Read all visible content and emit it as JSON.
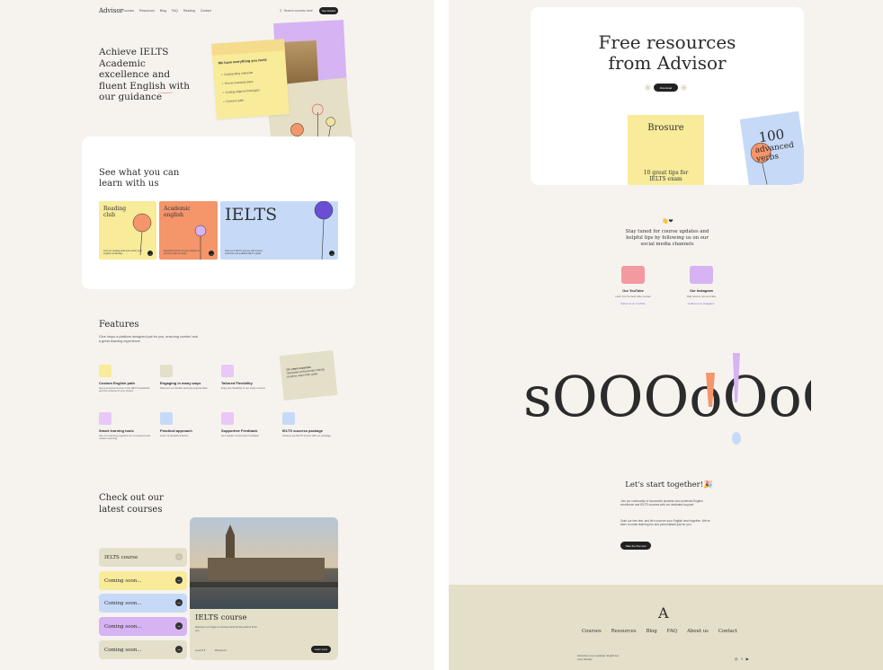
{
  "nav": {
    "logo": "Advisor",
    "links": [
      "Courses",
      "Resources",
      "Blog",
      "FAQ",
      "Reading",
      "Contact"
    ],
    "search_placeholder": "Search courses here",
    "cta": "Get started"
  },
  "hero": {
    "title": "Achieve IELTS Academic excellence and fluent English with our guidance",
    "note_heading": "We have everything you need:",
    "note_items": [
      "Outstanding materials",
      "Proven learning ways",
      "Cutting-edge technologies",
      "Genuine path"
    ]
  },
  "learn": {
    "title": "See what you can learn with us",
    "tiles": [
      {
        "title": "Reading club",
        "desc": "Join our reading club and enrich your english vocabulary",
        "color": "#f8eb9a"
      },
      {
        "title": "Academic english",
        "desc": "Expand horizons of your academic success with our team",
        "color": "#f4956a"
      },
      {
        "title": "IELTS",
        "desc": "Start your IELTS journey with proven methods and qualified IELTS guide",
        "color": "#c6daf8"
      }
    ]
  },
  "features": {
    "title": "Features",
    "subtitle": "Give Inspo a platform designed just for you, ensuring comfort and a great learning experience",
    "items": [
      {
        "name": "Custom English path",
        "desc": "Get a personal course in the IELTS standards and the scheme of your choice",
        "color": "#f8eb9a"
      },
      {
        "name": "Engaging in many ways",
        "desc": "Discover our flexible learning opportunities",
        "color": "#e4dfc8"
      },
      {
        "name": "Tailored Flexibility",
        "desc": "Enjoy the flexibility of our study courses",
        "color": "#e9c8f8"
      },
      {
        "name": "Smart learning tools",
        "desc": "Use our learning programs for convenient and modern learning",
        "color": "#e9c8f8"
      },
      {
        "name": "Practical approach",
        "desc": "Learn by English practice",
        "color": "#c6daf8"
      },
      {
        "name": "Supportive Feedback",
        "desc": "Get regular constructive feedback",
        "color": "#e9c8f8"
      },
      {
        "name": "IELTS success package",
        "desc": "Achieve top IELTS scores with our package",
        "color": "#c6daf8"
      }
    ],
    "quote_title": "10+ years expertise",
    "quote_text": "Dedicated professionals helping students reach their goals"
  },
  "courses": {
    "title": "Check out our latest courses",
    "pills": [
      {
        "label": "IELTS course",
        "color": "#e4dfc8"
      },
      {
        "label": "Coming soon...",
        "color": "#f8eb9a"
      },
      {
        "label": "Coming soon...",
        "color": "#c6daf8"
      },
      {
        "label": "Coming soon...",
        "color": "#d6b3f2"
      },
      {
        "label": "Coming soon...",
        "color": "#e4dfc8"
      }
    ],
    "card": {
      "title": "IELTS course",
      "desc": "Discover our range of courses and find the perfect fit for you",
      "meta": [
        "Level 5.5",
        "18 lessons"
      ],
      "button": "Learn more"
    }
  },
  "resources": {
    "title": "Free resources from Advisor",
    "download": "Download",
    "brochure_title": "Brosure",
    "brochure_sub": "10 great tips for IELTS exam",
    "verbs_num": "100",
    "verbs_text": "advanced verbs"
  },
  "social": {
    "emoji": "👋❤",
    "heading": "Stay tuned for course updates and helpful tips by following us on our social media channels",
    "items": [
      {
        "name": "Our YouTube",
        "desc": "Learn from the best video courses",
        "link": "Follow us on YouTube",
        "color": "#f29aa0"
      },
      {
        "name": "Our Instagram",
        "desc": "Daily lessons, tips and tricks",
        "link": "Follow us on Instagram",
        "color": "#d6b3f2"
      }
    ]
  },
  "start": {
    "title": "Let's start together!🎉",
    "p1": "Join our community of successful students who achieved English excellence and IELTS success with our dedicated support",
    "p2": "Grab our free test, and let's uncover your English level together. We've been to make learning fun and personalised just for you",
    "button": "Take the free test"
  },
  "footer": {
    "logo": "A",
    "links": [
      "Courses",
      "Resources",
      "Blog",
      "FAQ",
      "About us",
      "Contact"
    ],
    "small": "Subscribe to our newsletter. English tips every Monday",
    "social": [
      "◎",
      "f",
      "▶"
    ]
  },
  "soooo": "sOOOoOoO"
}
